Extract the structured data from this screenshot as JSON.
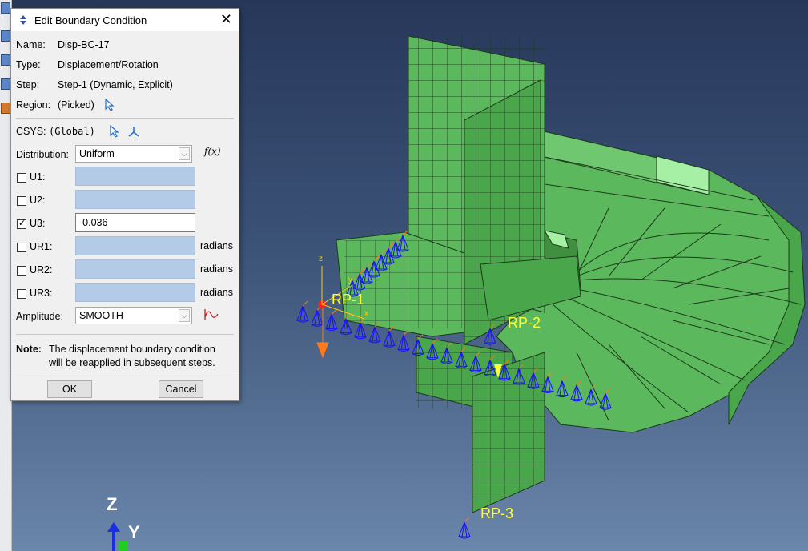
{
  "dialog": {
    "title": "Edit Boundary Condition",
    "name_label": "Name:",
    "name_value": "Disp-BC-17",
    "type_label": "Type:",
    "type_value": "Displacement/Rotation",
    "step_label": "Step:",
    "step_value": "Step-1 (Dynamic, Explicit)",
    "region_label": "Region:",
    "region_value": "(Picked)",
    "csys_label": "CSYS:",
    "csys_value": "(Global)",
    "distribution_label": "Distribution:",
    "distribution_value": "Uniform",
    "fx_label": "f(x)",
    "u1_label": "U1:",
    "u1_checked": false,
    "u1_value": "",
    "u2_label": "U2:",
    "u2_checked": false,
    "u2_value": "",
    "u3_label": "U3:",
    "u3_checked": true,
    "u3_value": "-0.036",
    "ur1_label": "UR1:",
    "ur1_checked": false,
    "ur1_value": "",
    "ur1_unit": "radians",
    "ur2_label": "UR2:",
    "ur2_checked": false,
    "ur2_value": "",
    "ur2_unit": "radians",
    "ur3_label": "UR3:",
    "ur3_checked": false,
    "ur3_value": "",
    "ur3_unit": "radians",
    "amplitude_label": "Amplitude:",
    "amplitude_value": "SMOOTH",
    "note_label": "Note:",
    "note_line1": "The displacement boundary condition",
    "note_line2": "will be reapplied in subsequent steps.",
    "ok_label": "OK",
    "cancel_label": "Cancel",
    "close_symbol": "✕"
  },
  "viewport": {
    "reference_points": [
      "RP-1",
      "RP-2",
      "RP-3"
    ],
    "triad_z": "Z",
    "triad_y": "Y",
    "local_z": "z",
    "local_y": "y",
    "local_x": "x",
    "colors": {
      "mesh_face": "#5cb85c",
      "mesh_light": "#8fd88f",
      "mesh_edge": "#1d3a1d",
      "bc_symbol": "#1a10ff",
      "bc_accent": "#ff7a1a",
      "rp_label": "#ffff33"
    }
  }
}
